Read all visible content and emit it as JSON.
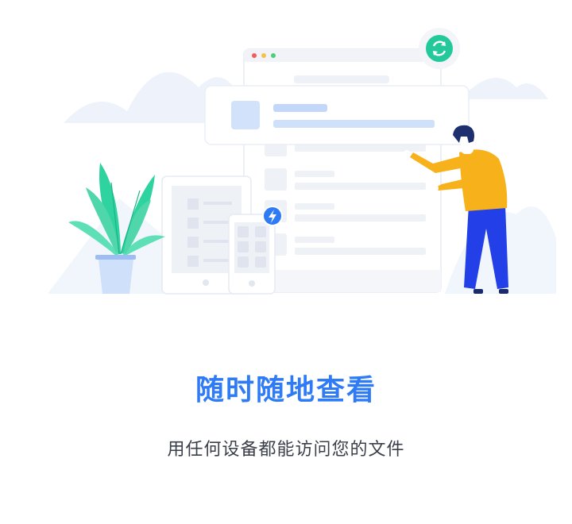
{
  "onboarding": {
    "title": "随时随地查看",
    "subtitle": "用任何设备都能访问您的文件"
  },
  "illustration": {
    "icons": [
      "sync-icon",
      "lightning-icon"
    ],
    "colors": {
      "accent_blue": "#2f7bf5",
      "sync_green": "#23c99a",
      "plant_green": "#2ed3a0",
      "shirt_yellow": "#f7b21b",
      "pants_blue": "#2340e8"
    }
  }
}
